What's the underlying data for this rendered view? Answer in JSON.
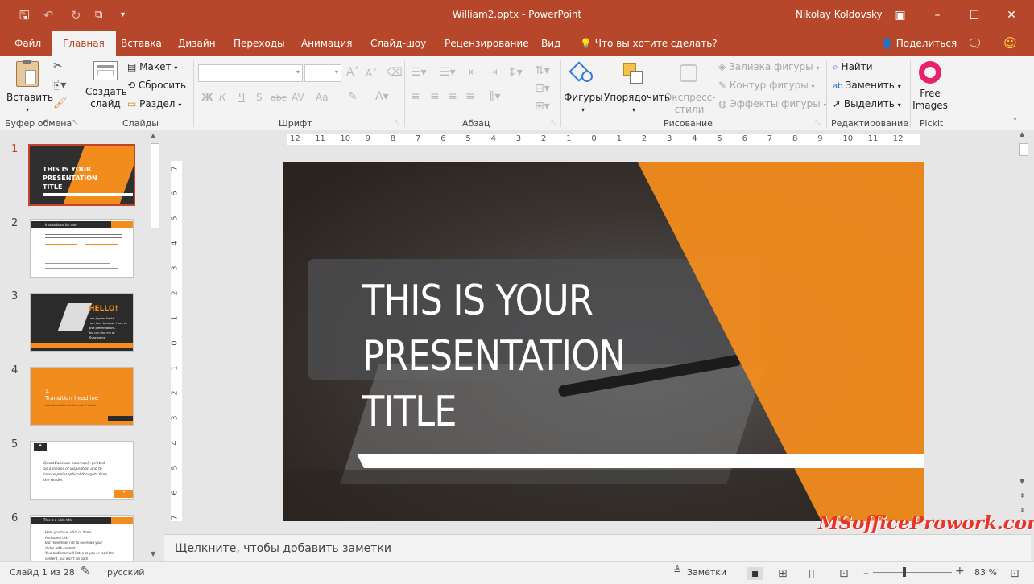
{
  "window": {
    "title": "William2.pptx  -  PowerPoint",
    "user": "Nikolay Koldovsky"
  },
  "tabs": [
    "Файл",
    "Главная",
    "Вставка",
    "Дизайн",
    "Переходы",
    "Анимация",
    "Слайд-шоу",
    "Рецензирование",
    "Вид"
  ],
  "tell_me": "Что вы хотите сделать?",
  "share_label": "Поделиться",
  "ribbon": {
    "clipboard": {
      "paste": "Вставить",
      "group": "Буфер обмена"
    },
    "slides": {
      "new_slide_1": "Создать",
      "new_slide_2": "слайд",
      "layout": "Макет",
      "reset": "Сбросить",
      "section": "Раздел",
      "group": "Слайды"
    },
    "font": {
      "bold": "Ж",
      "italic": "К",
      "underline": "Ч",
      "shadow": "S",
      "strike": "abc",
      "spacing": "AV",
      "case": "Aa",
      "group": "Шрифт"
    },
    "paragraph": {
      "group": "Абзац"
    },
    "drawing": {
      "shapes": "Фигуры",
      "arrange": "Упорядочить",
      "quick_1": "Экспресс-",
      "quick_2": "стили",
      "fill": "Заливка фигуры",
      "outline": "Контур фигуры",
      "effects": "Эффекты фигуры",
      "group": "Рисование"
    },
    "editing": {
      "find": "Найти",
      "replace": "Заменить",
      "select": "Выделить",
      "group": "Редактирование"
    },
    "pickit": {
      "free_1": "Free",
      "free_2": "Images",
      "group": "Pickit"
    }
  },
  "ruler": {
    "horizontal": [
      "12",
      "11",
      "10",
      "9",
      "8",
      "7",
      "6",
      "5",
      "4",
      "3",
      "2",
      "1",
      "0",
      "1",
      "2",
      "3",
      "4",
      "5",
      "6",
      "7",
      "8",
      "9",
      "10",
      "11",
      "12"
    ],
    "vertical": [
      "7",
      "6",
      "5",
      "4",
      "3",
      "2",
      "1",
      "0",
      "1",
      "2",
      "3",
      "4",
      "5",
      "6",
      "7"
    ]
  },
  "thumbnails": [
    {
      "num": "1",
      "title_1": "THIS IS YOUR",
      "title_2": "PRESENTATION",
      "title_3": "TITLE"
    },
    {
      "num": "2",
      "title": "Instructions for use"
    },
    {
      "num": "3",
      "title": "HELLO!",
      "line_1": "I am Jayden Smith",
      "line_2": "I am here because I love to",
      "line_3": "give presentations.",
      "line_4": "You can find me at",
      "line_5": "@username"
    },
    {
      "num": "4",
      "title_1": "1.",
      "title_2": "Transition headline",
      "sub": "Let's start with the first set of slides"
    },
    {
      "num": "5",
      "quote_1": "Quotations are commonly printed",
      "quote_2": "as a means of inspiration and to",
      "quote_3": "invoke philosophical thoughts from",
      "quote_4": "the reader."
    },
    {
      "num": "6",
      "title": "This is a slide title",
      "line_1": "Here you have a list of items",
      "line_2": "And some text",
      "line_3": "But remember not to overload your",
      "line_4": "slides with content",
      "line_5": "Your audience will listen to you or read the",
      "line_6": "content, but won't do both."
    }
  ],
  "slide": {
    "title_1": "THIS IS YOUR",
    "title_2": "PRESENTATION",
    "title_3": "TITLE"
  },
  "notes_placeholder": "Щелкните, чтобы добавить заметки",
  "status": {
    "slide": "Слайд 1 из 28",
    "language": "русский",
    "notes": "Заметки",
    "zoom": "83 %"
  },
  "watermark": "MSofficeProwork.com",
  "colors": {
    "accent": "#b7472a",
    "orange": "#f28c1c",
    "dark": "#2b2b2b"
  }
}
